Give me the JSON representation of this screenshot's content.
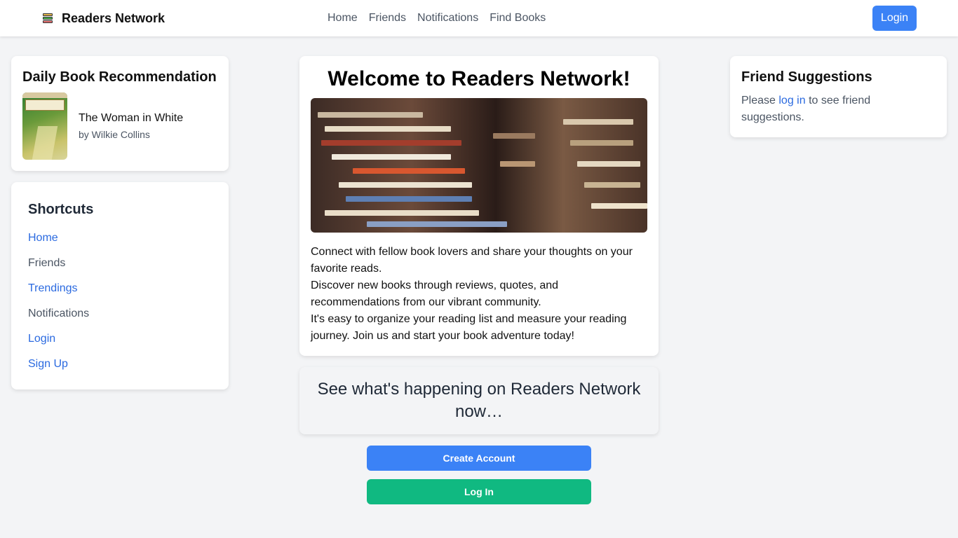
{
  "nav": {
    "brand": "Readers Network",
    "links": [
      "Home",
      "Friends",
      "Notifications",
      "Find Books"
    ],
    "login_label": "Login"
  },
  "daily": {
    "heading": "Daily Book Recommendation",
    "book_title": "The Woman in White",
    "book_author": "by Wilkie Collins"
  },
  "shortcuts": {
    "heading": "Shortcuts",
    "items": [
      "Home",
      "Friends",
      "Trendings",
      "Notifications",
      "Login",
      "Sign Up"
    ]
  },
  "welcome": {
    "heading": "Welcome to Readers Network!",
    "line1": "Connect with fellow book lovers and share your thoughts on your favorite reads.",
    "line2": "Discover new books through reviews, quotes, and recommendations from our vibrant community.",
    "line3": "It's easy to organize your reading list and measure your reading journey. Join us and start your book adventure today!"
  },
  "happening": {
    "text": "See what's happening on Readers Network now…"
  },
  "buttons": {
    "create_account": "Create Account",
    "log_in": "Log In"
  },
  "friends": {
    "heading": "Friend Suggestions",
    "prefix": "Please ",
    "link": "log in",
    "suffix": " to see friend suggestions."
  },
  "colors": {
    "primary": "#3b82f6",
    "success": "#10b981",
    "link": "#2b6ae0",
    "background": "#f3f4f6"
  }
}
